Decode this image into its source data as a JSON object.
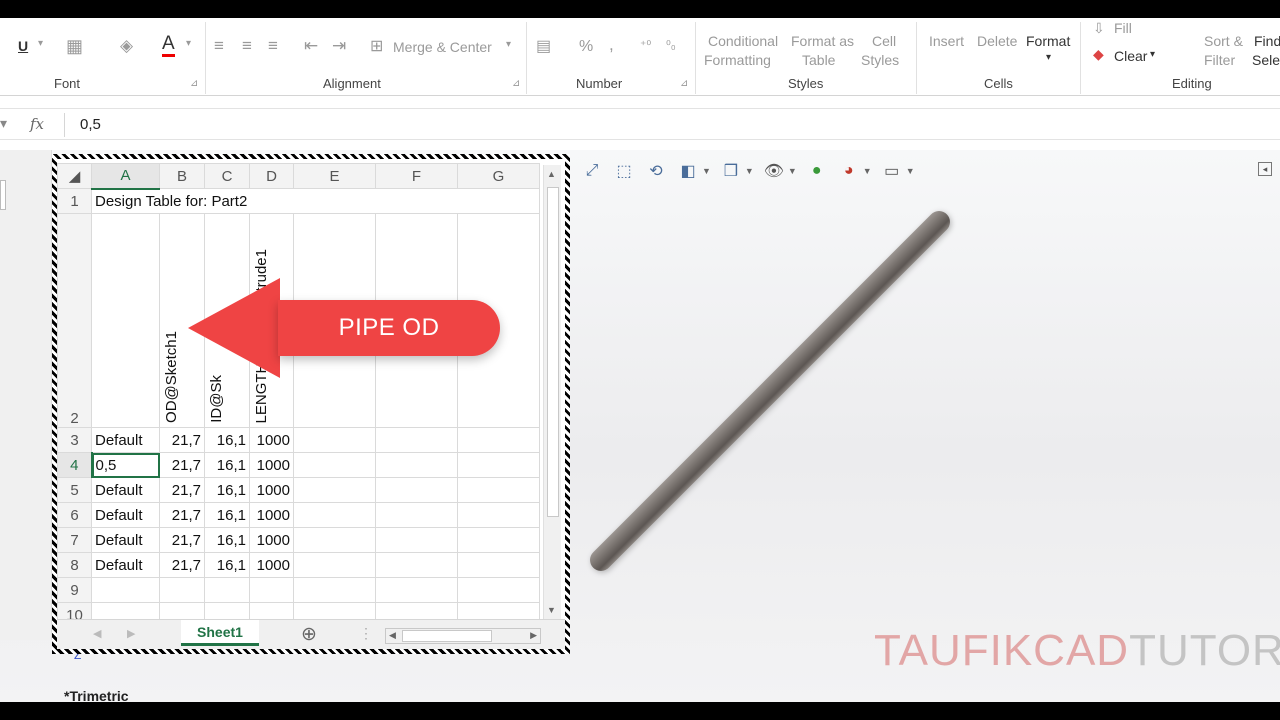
{
  "ribbon": {
    "font_group": "Font",
    "alignment_group": "Alignment",
    "merge_center": "Merge & Center",
    "number_group": "Number",
    "percent": "%",
    "comma": ",",
    "conditional_formatting": [
      "Conditional",
      "Formatting"
    ],
    "format_as_table": [
      "Format as",
      "Table"
    ],
    "cell_styles": [
      "Cell",
      "Styles"
    ],
    "styles_group": "Styles",
    "insert": "Insert",
    "delete": "Delete",
    "format": "Format",
    "cells_group": "Cells",
    "fill": "Fill",
    "clear": "Clear",
    "sort_filter": [
      "Sort &",
      "Filter"
    ],
    "find_select": [
      "Find",
      "Sele"
    ],
    "editing_group": "Editing",
    "underline": "U"
  },
  "formula_bar": {
    "fx": "fx",
    "value": "0,5"
  },
  "sheet": {
    "columns": [
      "A",
      "B",
      "C",
      "D",
      "E",
      "F",
      "G"
    ],
    "row1_title": "Design Table for: Part2",
    "headers": [
      "OD@Sketch1",
      "ID@Sk",
      "LENGTH@Boss-Extrude1"
    ],
    "rows": [
      {
        "n": "3",
        "a": "Default",
        "b": "21,7",
        "c": "16,1",
        "d": "1000"
      },
      {
        "n": "4",
        "a": "0,5",
        "b": "21,7",
        "c": "16,1",
        "d": "1000"
      },
      {
        "n": "5",
        "a": "Default",
        "b": "21,7",
        "c": "16,1",
        "d": "1000"
      },
      {
        "n": "6",
        "a": "Default",
        "b": "21,7",
        "c": "16,1",
        "d": "1000"
      },
      {
        "n": "7",
        "a": "Default",
        "b": "21,7",
        "c": "16,1",
        "d": "1000"
      },
      {
        "n": "8",
        "a": "Default",
        "b": "21,7",
        "c": "16,1",
        "d": "1000"
      }
    ],
    "tab_name": "Sheet1"
  },
  "callout": {
    "text": "PIPE OD",
    "color": "#ef4444"
  },
  "viewport": {
    "view_name": "*Trimetric",
    "axis": "Z"
  },
  "watermark": {
    "part1": "TAUFIKCAD",
    "part2": "TUTOR"
  }
}
